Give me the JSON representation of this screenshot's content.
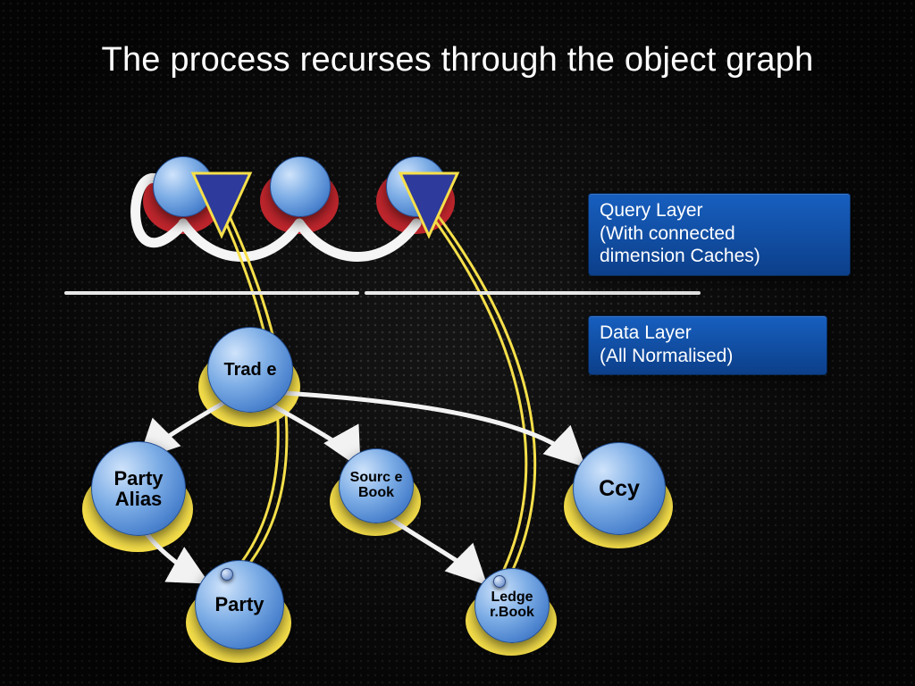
{
  "title": "The process recurses through the object graph",
  "labels": {
    "query_layer": "Query Layer\n(With connected\ndimension Caches)",
    "data_layer": "Data Layer\n(All Normalised)"
  },
  "nodes": {
    "trade": "Trad\ne",
    "party_alias": "Party\nAlias",
    "source_book": "Sourc\ne\nBook",
    "ccy": "Ccy",
    "party": "Party",
    "ledger_book": "Ledge\nr.Book"
  }
}
